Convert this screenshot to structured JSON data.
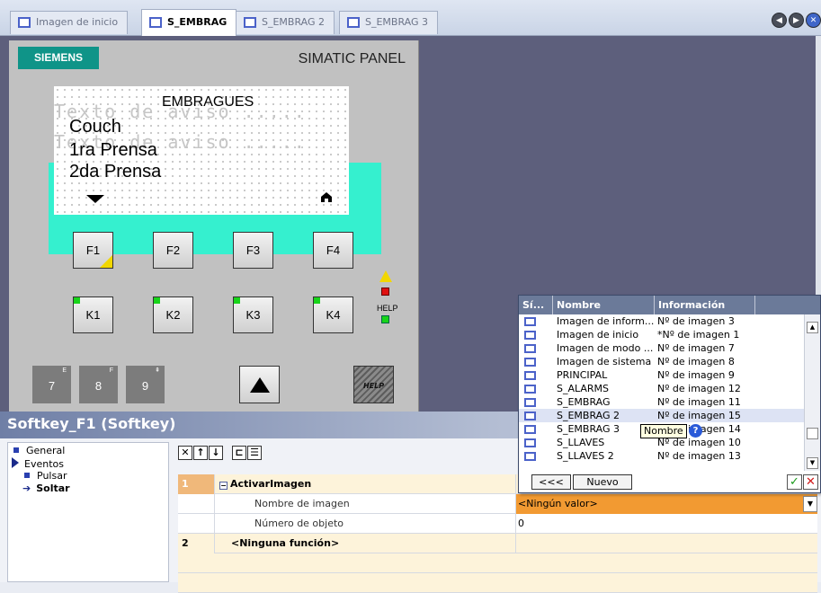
{
  "tabs": [
    {
      "label": "Imagen de inicio",
      "active": false
    },
    {
      "label": "S_EMBRAG",
      "active": true
    },
    {
      "label": "S_EMBRAG 2",
      "active": false
    },
    {
      "label": "S_EMBRAG 3",
      "active": false
    }
  ],
  "device": {
    "brand": "SIEMENS",
    "model": "SIMATIC PANEL",
    "lcd": {
      "title": "EMBRAGUES",
      "ghost_line_1": "Texto de aviso .....",
      "ghost_line_2": "Texto de aviso .....",
      "lines": [
        "Couch",
        "1ra Prensa",
        "2da Prensa"
      ]
    },
    "fkeys": [
      "F1",
      "F2",
      "F3",
      "F4"
    ],
    "kkeys": [
      "K1",
      "K2",
      "K3",
      "K4"
    ],
    "help_label": "HELP",
    "numkeys": [
      {
        "label": "7",
        "sup": "E"
      },
      {
        "label": "8",
        "sup": "F"
      },
      {
        "label": "9",
        "sup": "⇞"
      }
    ],
    "help_key": "HELP"
  },
  "properties": {
    "title": "Softkey_F1 (Softkey)",
    "tree": [
      {
        "label": "General",
        "level": 0
      },
      {
        "label": "Eventos",
        "level": 0
      },
      {
        "label": "Pulsar",
        "level": 1
      },
      {
        "label": "Soltar",
        "level": 1,
        "selected": true
      }
    ],
    "toolbar": [
      "✕",
      "↑",
      "↓",
      "⊏",
      "☰"
    ],
    "rows": [
      {
        "num": "1",
        "name": "ActivarImagen",
        "value": ""
      },
      {
        "num": "",
        "name": "Nombre de imagen",
        "value": "<Ningún valor>"
      },
      {
        "num": "",
        "name": "Número de objeto",
        "value": "0"
      },
      {
        "num": "2",
        "name": "<Ninguna función>",
        "value": ""
      }
    ]
  },
  "picker": {
    "headers": [
      "Sí...",
      "Nombre",
      "Información"
    ],
    "rows": [
      {
        "name": "Imagen de inform...",
        "info": "Nº de imagen 3"
      },
      {
        "name": "Imagen de inicio",
        "info": "*Nº de imagen 1"
      },
      {
        "name": "Imagen de modo ...",
        "info": "Nº de imagen 7"
      },
      {
        "name": "Imagen de sistema",
        "info": "Nº de imagen 8"
      },
      {
        "name": "PRINCIPAL",
        "info": "Nº de imagen 9"
      },
      {
        "name": "S_ALARMS",
        "info": "Nº de imagen 12"
      },
      {
        "name": "S_EMBRAG",
        "info": "Nº de imagen 11"
      },
      {
        "name": "S_EMBRAG 2",
        "info": "Nº de imagen 15",
        "selected": true
      },
      {
        "name": "S_EMBRAG 3",
        "info": "Nº de imagen 14"
      },
      {
        "name": "S_LLAVES",
        "info": "Nº de imagen 10"
      },
      {
        "name": "S_LLAVES 2",
        "info": "Nº de imagen 13"
      }
    ],
    "back_label": "<<<",
    "new_label": "Nuevo",
    "tooltip": "Nombre"
  },
  "colors": {
    "brand_green": "#0f9488",
    "screen_band": "#35f0cf",
    "canvas_bg": "#5d5f7c",
    "function_row": "#f0b87a",
    "value_highlight": "#f29a32"
  }
}
